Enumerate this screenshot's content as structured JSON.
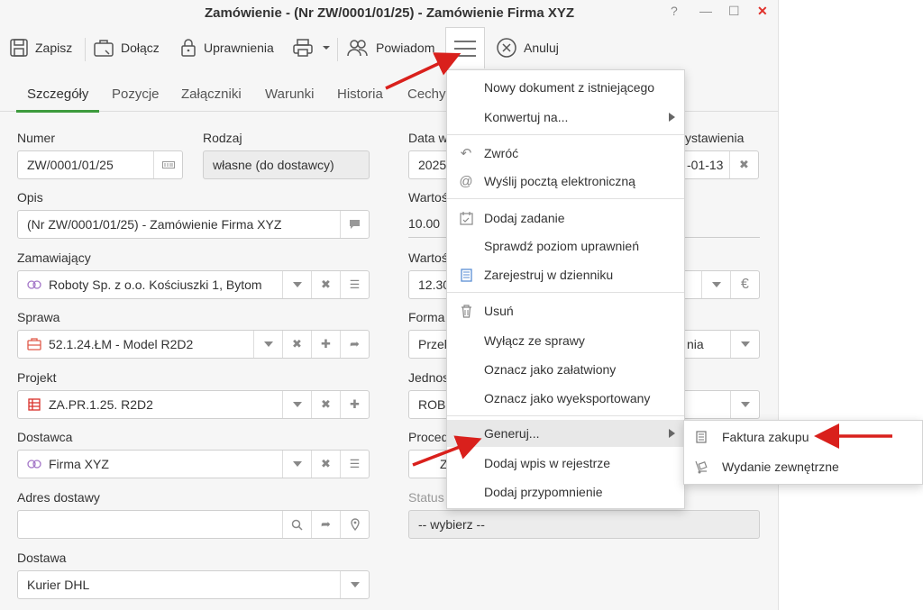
{
  "window": {
    "title": "Zamówienie - (Nr ZW/0001/01/25) - Zamówienie Firma XYZ",
    "help": "?",
    "minimize": "—",
    "maximize": "☐",
    "close": "✕"
  },
  "toolbar": {
    "save": "Zapisz",
    "attach": "Dołącz",
    "permissions": "Uprawnienia",
    "notify": "Powiadom",
    "cancel": "Anuluj"
  },
  "tabs": [
    "Szczegóły",
    "Pozycje",
    "Załączniki",
    "Warunki",
    "Historia",
    "Cechy"
  ],
  "left": {
    "numer": {
      "label": "Numer",
      "value": "ZW/0001/01/25"
    },
    "rodzaj": {
      "label": "Rodzaj",
      "value": "własne (do dostawcy)"
    },
    "opis": {
      "label": "Opis",
      "value": "(Nr ZW/0001/01/25) - Zamówienie Firma XYZ"
    },
    "zamawiajacy": {
      "label": "Zamawiający",
      "value": "Roboty Sp. z o.o. Kościuszki 1, Bytom"
    },
    "sprawa": {
      "label": "Sprawa",
      "value": "52.1.24.ŁM - Model R2D2"
    },
    "projekt": {
      "label": "Projekt",
      "value": "ZA.PR.1.25. R2D2"
    },
    "dostawca": {
      "label": "Dostawca",
      "value": "Firma XYZ"
    },
    "adres": {
      "label": "Adres dostawy",
      "value": ""
    },
    "dostawa": {
      "label": "Dostawa",
      "value": "Kurier DHL"
    }
  },
  "right": {
    "data_w": {
      "label": "Data w",
      "value": "2025"
    },
    "data_wyst": {
      "label": "ystawienia",
      "value": "-01-13"
    },
    "wartosc1": {
      "label": "Wartoś",
      "value": "10.00"
    },
    "wartosc2": {
      "label": "Wartoś",
      "value": "12.30"
    },
    "forma": {
      "label": "Forma",
      "value": "Przele",
      "tail": "nia"
    },
    "jednostka": {
      "label": "Jednos",
      "value": "ROBO"
    },
    "procedura": {
      "label": "Proced",
      "value": "Z"
    },
    "status": {
      "label": "Status",
      "value": "-- wybierz --"
    },
    "currency_symbol": "€"
  },
  "menu": {
    "items": [
      "Nowy dokument z istniejącego",
      "Konwertuj na...",
      "Zwróć",
      "Wyślij pocztą elektroniczną",
      "Dodaj zadanie",
      "Sprawdź poziom uprawnień",
      "Zarejestruj w dzienniku",
      "Usuń",
      "Wyłącz ze sprawy",
      "Oznacz jako załatwiony",
      "Oznacz jako wyeksportowany",
      "Generuj...",
      "Dodaj wpis w rejestrze",
      "Dodaj przypomnienie"
    ]
  },
  "submenu": {
    "items": [
      "Faktura zakupu",
      "Wydanie zewnętrzne"
    ]
  },
  "colors": {
    "accent_green": "#3d9b3d",
    "annotation_red": "#d9201c",
    "close_red": "#e0302a"
  }
}
